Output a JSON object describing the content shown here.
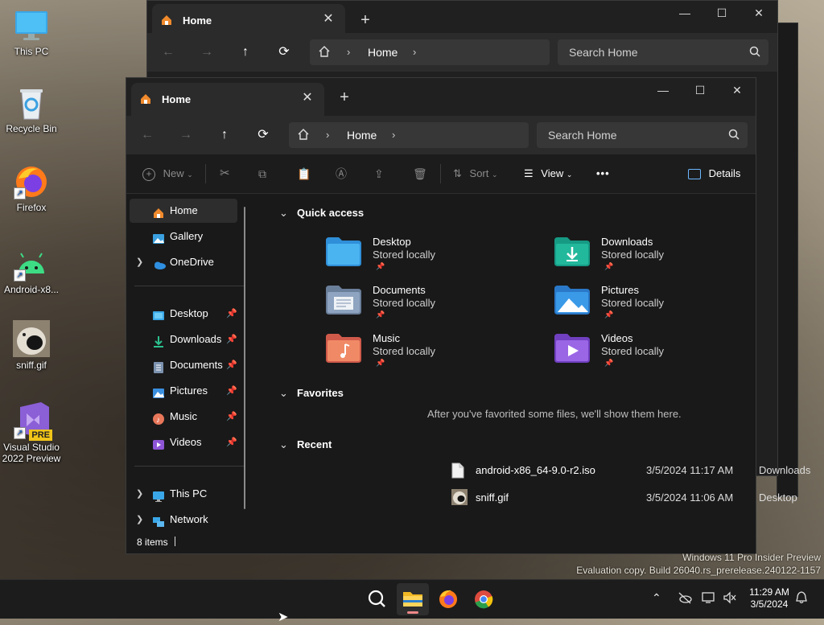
{
  "desktop": {
    "icons": [
      {
        "label": "This PC"
      },
      {
        "label": "Recycle Bin"
      },
      {
        "label": "Firefox"
      },
      {
        "label": "Android-x8..."
      },
      {
        "label": "sniff.gif"
      },
      {
        "label": "Visual Studio 2022 Preview",
        "badge": "PRE"
      }
    ]
  },
  "back_window": {
    "tab_title": "Home",
    "crumb": "Home",
    "search_placeholder": "Search Home"
  },
  "window": {
    "tab_title": "Home",
    "new_tab": "+",
    "crumb": "Home",
    "search_placeholder": "Search Home",
    "toolbar": {
      "new_label": "New",
      "sort_label": "Sort",
      "view_label": "View",
      "more_label": "•••",
      "details_label": "Details"
    },
    "sidebar": {
      "top": [
        {
          "label": "Home",
          "icon": "home-icon",
          "selected": true
        },
        {
          "label": "Gallery",
          "icon": "gallery-icon"
        },
        {
          "label": "OneDrive",
          "icon": "onedrive-icon",
          "expandable": true
        }
      ],
      "pinned": [
        {
          "label": "Desktop",
          "icon": "desktop-folder-icon"
        },
        {
          "label": "Downloads",
          "icon": "downloads-folder-icon"
        },
        {
          "label": "Documents",
          "icon": "documents-folder-icon"
        },
        {
          "label": "Pictures",
          "icon": "pictures-folder-icon"
        },
        {
          "label": "Music",
          "icon": "music-folder-icon"
        },
        {
          "label": "Videos",
          "icon": "videos-folder-icon"
        }
      ],
      "bottom": [
        {
          "label": "This PC",
          "icon": "this-pc-icon",
          "expandable": true
        },
        {
          "label": "Network",
          "icon": "network-icon",
          "expandable": true
        }
      ]
    },
    "content": {
      "quick_access_title": "Quick access",
      "quick_access": [
        {
          "name": "Desktop",
          "sub": "Stored locally",
          "color": "#2f8fd8"
        },
        {
          "name": "Downloads",
          "sub": "Stored locally",
          "color": "#1aa58e"
        },
        {
          "name": "Documents",
          "sub": "Stored locally",
          "color": "#7c93b0"
        },
        {
          "name": "Pictures",
          "sub": "Stored locally",
          "color": "#3a8fe0"
        },
        {
          "name": "Music",
          "sub": "Stored locally",
          "color": "#e8775a"
        },
        {
          "name": "Videos",
          "sub": "Stored locally",
          "color": "#8e55d6"
        }
      ],
      "favorites_title": "Favorites",
      "favorites_message": "After you've favorited some files, we'll show them here.",
      "recent_title": "Recent",
      "recent": [
        {
          "name": "android-x86_64-9.0-r2.iso",
          "date": "3/5/2024 11:17 AM",
          "location": "Downloads"
        },
        {
          "name": "sniff.gif",
          "date": "3/5/2024 11:06 AM",
          "location": "Desktop"
        }
      ]
    },
    "status": {
      "count": "8 items"
    }
  },
  "watermark": {
    "line1": "Windows 11 Pro Insider Preview",
    "line2": "Evaluation copy. Build 26040.rs_prerelease.240122-1157"
  },
  "taskbar": {
    "time": "11:29 AM",
    "date": "3/5/2024"
  }
}
